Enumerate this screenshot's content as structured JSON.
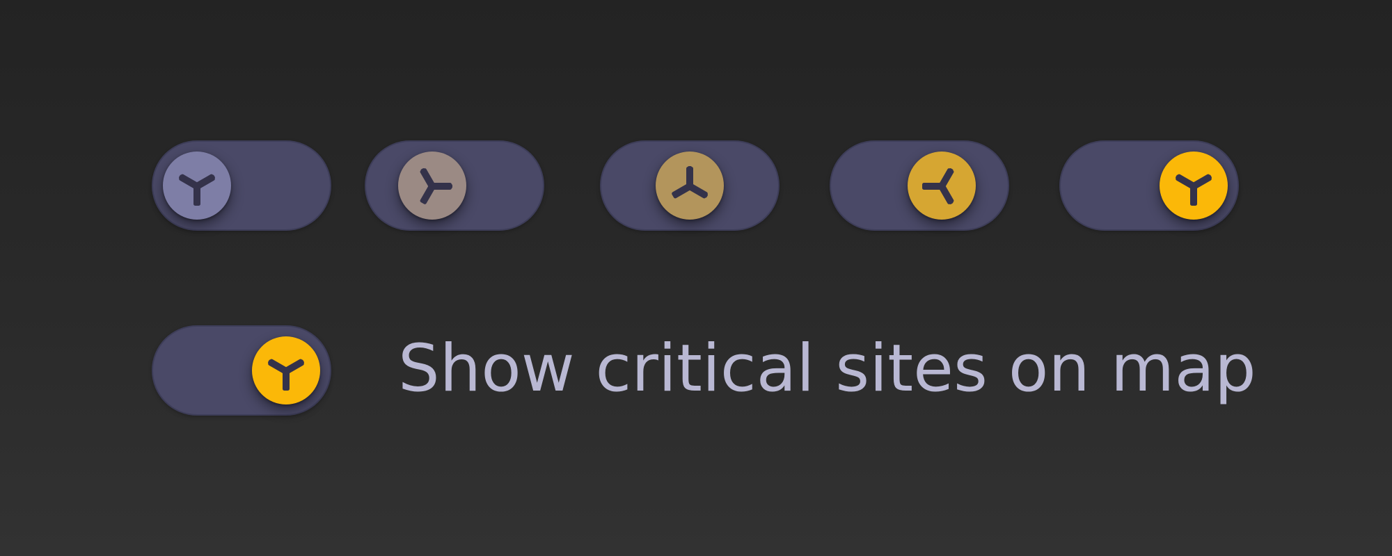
{
  "toggle_row": {
    "states": [
      {
        "knob_color": "#7e7ea6",
        "icon": "three-blade-icon",
        "progress": 0.0
      },
      {
        "knob_color": "#9b8a84",
        "icon": "three-blade-icon",
        "progress": 0.25
      },
      {
        "knob_color": "#b3955c",
        "icon": "three-blade-icon",
        "progress": 0.5
      },
      {
        "knob_color": "#d6a632",
        "icon": "three-blade-icon",
        "progress": 0.75
      },
      {
        "knob_color": "#fbb808",
        "icon": "three-blade-icon",
        "progress": 1.0
      }
    ]
  },
  "setting": {
    "label": "Show critical sites on map",
    "state": "on",
    "knob_color": "#fbb808",
    "icon": "three-blade-icon"
  },
  "colors": {
    "track": "#4a4967",
    "icon_glyph": "#34324a",
    "label_text": "#b9b8d3",
    "accent": "#fbb808"
  }
}
